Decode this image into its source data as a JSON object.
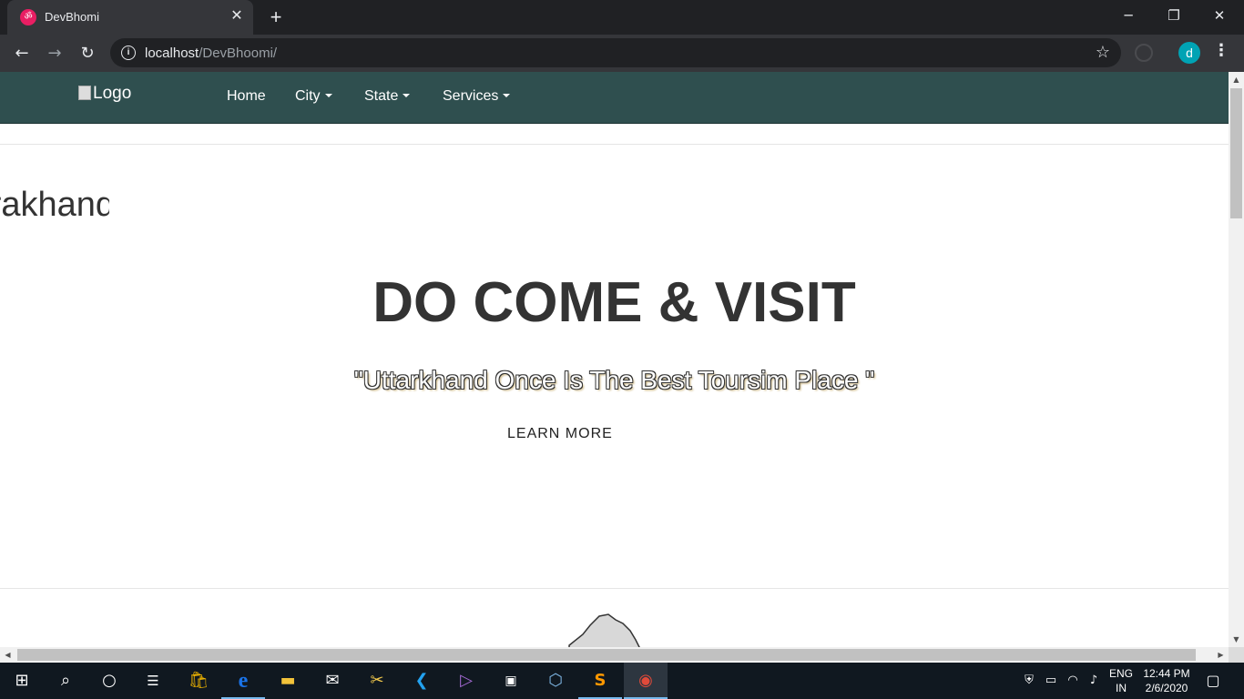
{
  "browser": {
    "tab_title": "DevBhomi",
    "tab_favicon": "ॐ",
    "close_tab": "✕",
    "new_tab": "+",
    "url_host": "localhost",
    "url_path": "/DevBhoomi/",
    "avatar_letter": "d",
    "back": "←",
    "forward": "→",
    "reload": "↻",
    "star": "☆",
    "menu": "⋮",
    "minimize": "─",
    "restore": "❐",
    "close": "✕"
  },
  "site": {
    "logo_alt": "Logo",
    "nav": [
      {
        "label": "Home",
        "dropdown": false
      },
      {
        "label": "City",
        "dropdown": true
      },
      {
        "label": "State",
        "dropdown": true
      },
      {
        "label": "Services",
        "dropdown": true
      }
    ],
    "marquee_text": "Uttarakhand",
    "hero_title": "DO COME & VISIT",
    "hero_subtitle": "\"Uttarkhand Once Is The Best Toursim Place \"",
    "learn_more": "LEARN MORE"
  },
  "taskbar": {
    "apps": [
      "start-icon",
      "search-icon",
      "cortana-icon",
      "task-view-icon",
      "store-icon",
      "edge-icon",
      "file-explorer-icon",
      "mail-icon",
      "tools-icon",
      "vscode-icon",
      "visual-studio-icon",
      "terminal-icon",
      "virtualbox-icon",
      "sublime-icon",
      "chrome-icon"
    ],
    "language": "ENG",
    "region": "IN",
    "time": "12:44 PM",
    "date": "2/6/2020"
  },
  "colors": {
    "navbar": "#2f4f4f",
    "chrome_dark": "#202124",
    "taskbar": "#101820"
  }
}
